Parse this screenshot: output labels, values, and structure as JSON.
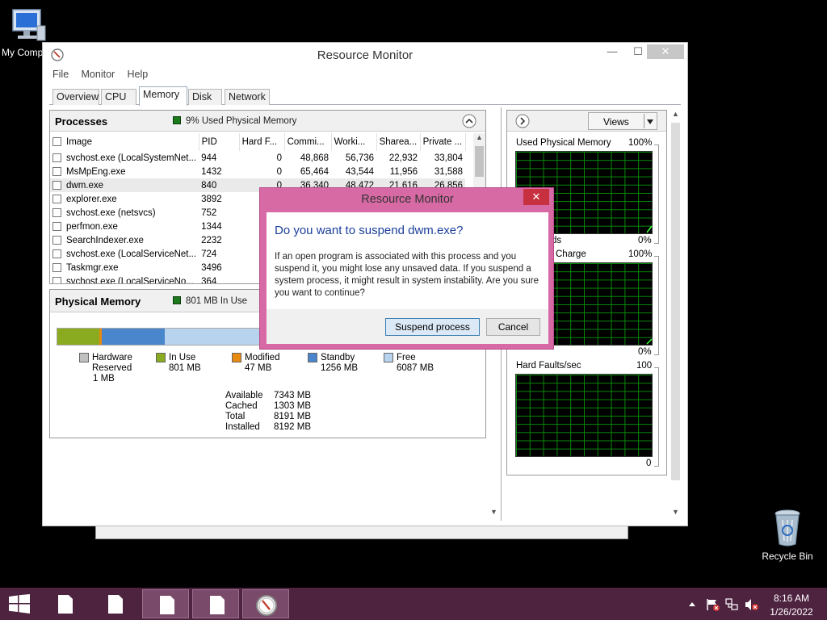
{
  "desktop": {
    "my_computer_label": "My Comp",
    "recycle_bin_label": "Recycle Bin"
  },
  "window": {
    "title": "Resource Monitor",
    "minimize": "—",
    "maximize": "☐",
    "close": "✕",
    "menu": [
      "File",
      "Monitor",
      "Help"
    ],
    "tabs": [
      "Overview",
      "CPU",
      "Memory",
      "Disk",
      "Network"
    ],
    "active_tab": "Memory"
  },
  "processes": {
    "title": "Processes",
    "status": "9% Used Physical Memory",
    "columns": [
      "Image",
      "PID",
      "Hard F...",
      "Commi...",
      "Worki...",
      "Sharea...",
      "Private ..."
    ],
    "rows": [
      [
        "svchost.exe (LocalSystemNet...",
        "944",
        "0",
        "48,868",
        "56,736",
        "22,932",
        "33,804"
      ],
      [
        "MsMpEng.exe",
        "1432",
        "0",
        "65,464",
        "43,544",
        "11,956",
        "31,588"
      ],
      [
        "dwm.exe",
        "840",
        "0",
        "36,340",
        "48,472",
        "21,616",
        "26,856"
      ],
      [
        "explorer.exe",
        "3892",
        "",
        "",
        "",
        "",
        ""
      ],
      [
        "svchost.exe (netsvcs)",
        "752",
        "",
        "",
        "",
        "",
        ""
      ],
      [
        "perfmon.exe",
        "1344",
        "",
        "",
        "",
        "",
        ""
      ],
      [
        "SearchIndexer.exe",
        "2232",
        "",
        "",
        "",
        "",
        ""
      ],
      [
        "svchost.exe (LocalServiceNet...",
        "724",
        "",
        "",
        "",
        "",
        ""
      ],
      [
        "Taskmgr.exe",
        "3496",
        "",
        "",
        "",
        "",
        ""
      ],
      [
        "svchost.exe (LocalServiceNo...",
        "364",
        "",
        "",
        "",
        "",
        ""
      ]
    ]
  },
  "physical_memory": {
    "title": "Physical Memory",
    "status": "801 MB In Use",
    "legend": [
      {
        "name": "Hardware Reserved",
        "l1": "Hardware",
        "l2": "Reserved",
        "value": "1 MB",
        "color": "#c0c0c0"
      },
      {
        "name": "In Use",
        "l1": "In Use",
        "l2": "801 MB",
        "value": "",
        "color": "#8aaa1f"
      },
      {
        "name": "Modified",
        "l1": "Modified",
        "l2": "47 MB",
        "value": "",
        "color": "#e88a10"
      },
      {
        "name": "Standby",
        "l1": "Standby",
        "l2": "1256 MB",
        "value": "",
        "color": "#4a86cc"
      },
      {
        "name": "Free",
        "l1": "Free",
        "l2": "6087 MB",
        "value": "",
        "color": "#b8d3ee"
      }
    ],
    "stats": [
      {
        "label": "Available",
        "value": "7343 MB"
      },
      {
        "label": "Cached",
        "value": "1303 MB"
      },
      {
        "label": "Total",
        "value": "8191 MB"
      },
      {
        "label": "Installed",
        "value": "8192 MB"
      }
    ]
  },
  "right_pane": {
    "views_label": "Views",
    "graphs": [
      {
        "label": "Used Physical Memory",
        "max": "100%",
        "min": "0%"
      },
      {
        "label": "Commit Charge",
        "label_visible": "Charge",
        "max": "100%",
        "min": "0%"
      },
      {
        "label": "Hard Faults/sec",
        "max": "100",
        "min": "0"
      }
    ],
    "partial_label": "ds"
  },
  "dialog": {
    "title": "Resource Monitor",
    "close": "✕",
    "heading": "Do you want to suspend dwm.exe?",
    "text": "If an open program is associated with this process and you suspend it, you might lose any unsaved data. If you suspend a system process, it might result in system instability. Are you sure you want to continue?",
    "primary_button": "Suspend process",
    "cancel_button": "Cancel"
  },
  "taskbar": {
    "time": "8:16 AM",
    "date": "1/26/2022"
  }
}
